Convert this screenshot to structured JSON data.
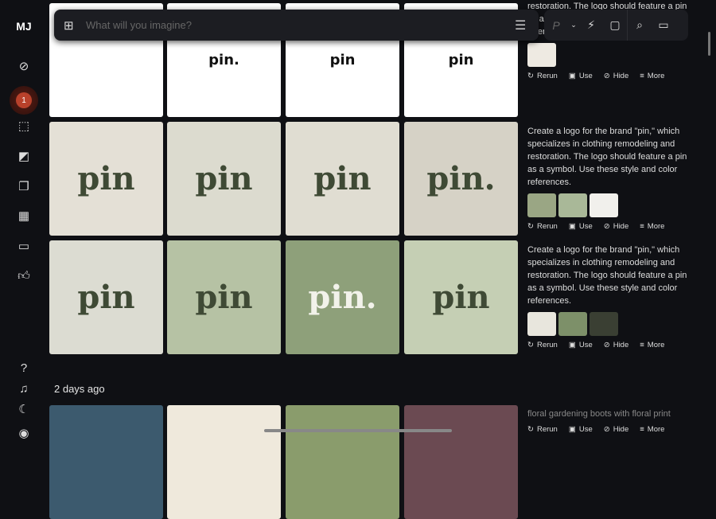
{
  "app": {
    "logo": "MJ",
    "notifications": "1"
  },
  "search": {
    "placeholder": "What will you imagine?"
  },
  "toolbar": {
    "personalize": "P"
  },
  "section_heading": "2 days ago",
  "rows": [
    {
      "prompt": "Create a logo for the brand \"pin,\" which specializes in clothing remodeling and restoration. The logo should feature a pin as a symbol. Use these style and color references.",
      "tiles": [
        {
          "label": "",
          "bg": "#ffffff"
        },
        {
          "label": "pin.",
          "bg": "#ffffff"
        },
        {
          "label": "pin",
          "bg": "#ffffff"
        },
        {
          "label": "pin",
          "bg": "#ffffff"
        }
      ],
      "thumbs": [
        "#eeeae2"
      ]
    },
    {
      "prompt": "Create a logo for the brand \"pin,\" which specializes in clothing remodeling and restoration. The logo should feature a pin as a symbol. Use these style and color references.",
      "tiles": [
        {
          "label": "pin",
          "bg": "#e4e0d6"
        },
        {
          "label": "pin",
          "bg": "#dcdbcf"
        },
        {
          "label": "pin",
          "bg": "#e0ddd2"
        },
        {
          "label": "pin.",
          "bg": "#d6d2c6"
        }
      ],
      "thumbs": [
        "#9aa684",
        "#a9b898",
        "#f1f0ec"
      ]
    },
    {
      "prompt": "Create a logo for the brand \"pin,\" which specializes in clothing remodeling and restoration. The logo should feature a pin as a symbol. Use these style and color references.",
      "tiles": [
        {
          "label": "pin",
          "bg": "#dcdcd2"
        },
        {
          "label": "pin",
          "bg": "#b6c2a4"
        },
        {
          "label": "pin.",
          "bg": "#8ea07a"
        },
        {
          "label": "pin",
          "bg": "#c5cfb4"
        }
      ],
      "thumbs": [
        "#e8e6dd",
        "#7d9069",
        "#3a3f33"
      ]
    },
    {
      "prompt": "floral gardening boots with floral print",
      "tiles": [
        {
          "label": "",
          "bg": "#3c5a6e"
        },
        {
          "label": "",
          "bg": "#efe9dc"
        },
        {
          "label": "",
          "bg": "#8a9c6c"
        },
        {
          "label": "",
          "bg": "#6b4a52"
        }
      ],
      "thumbs": []
    }
  ],
  "actions": {
    "rerun": "Rerun",
    "use": "Use",
    "hide": "Hide",
    "more": "More"
  }
}
